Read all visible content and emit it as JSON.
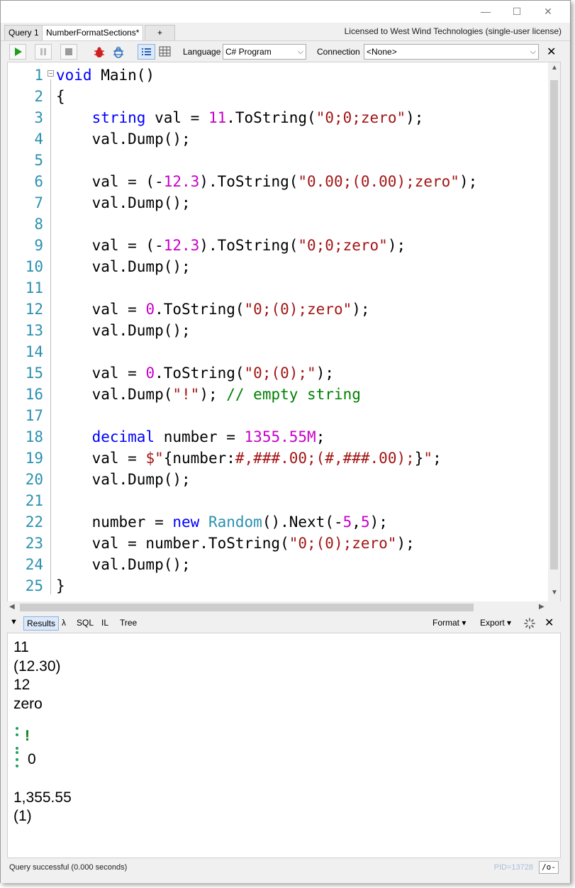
{
  "window": {
    "minimize": "—",
    "maximize": "☐",
    "close": "✕"
  },
  "tabs": [
    {
      "label": "Query 1"
    },
    {
      "label": "NumberFormatSections*"
    },
    {
      "label": "+"
    }
  ],
  "license_text": "Licensed to West Wind Technologies (single-user license)",
  "toolbar": {
    "language_label": "Language",
    "language_value": "C# Program",
    "connection_label": "Connection",
    "connection_value": "<None>",
    "close": "✕"
  },
  "editor": {
    "line_numbers": [
      "1",
      "2",
      "3",
      "4",
      "5",
      "6",
      "7",
      "8",
      "9",
      "10",
      "11",
      "12",
      "13",
      "14",
      "15",
      "16",
      "17",
      "18",
      "19",
      "20",
      "21",
      "22",
      "23",
      "24",
      "25"
    ]
  },
  "results_bar": {
    "tabs": [
      "Results",
      "λ",
      "SQL",
      "IL",
      "Tree"
    ],
    "format": "Format ▾",
    "export": "Export ▾",
    "close": "✕"
  },
  "results": {
    "lines": [
      "11",
      "(12.30)",
      "12",
      "zero",
      "!",
      "0",
      "1,355.55",
      "(1)"
    ]
  },
  "status": {
    "message": "Query successful  (0.000 seconds)",
    "pid": "PID=13728",
    "io": "/o-"
  },
  "colors": {
    "keyword": "#0000ff",
    "number": "#c800c8",
    "string": "#a31515",
    "comment": "#008000",
    "type": "#2b91af",
    "line_number": "#2b91af"
  }
}
